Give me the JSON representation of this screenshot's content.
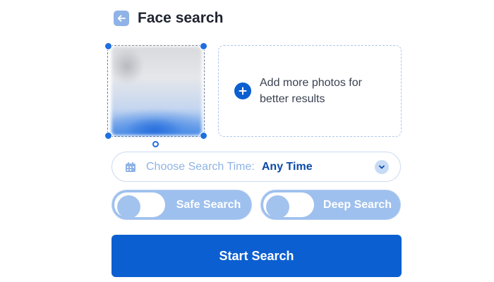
{
  "header": {
    "title": "Face search",
    "back_icon": "arrow-left-icon"
  },
  "photos": {
    "add_text": "Add more photos for better results",
    "add_icon": "plus-circle-icon"
  },
  "search_time": {
    "label": "Choose Search Time:",
    "value": "Any Time"
  },
  "toggles": [
    {
      "label": "Safe Search",
      "on": false
    },
    {
      "label": "Deep Search",
      "on": false
    }
  ],
  "actions": {
    "start_label": "Start Search"
  },
  "colors": {
    "accent": "#0c5fd0",
    "accent_light": "#9ec0ee",
    "accent_pale": "#8fb3e6"
  }
}
